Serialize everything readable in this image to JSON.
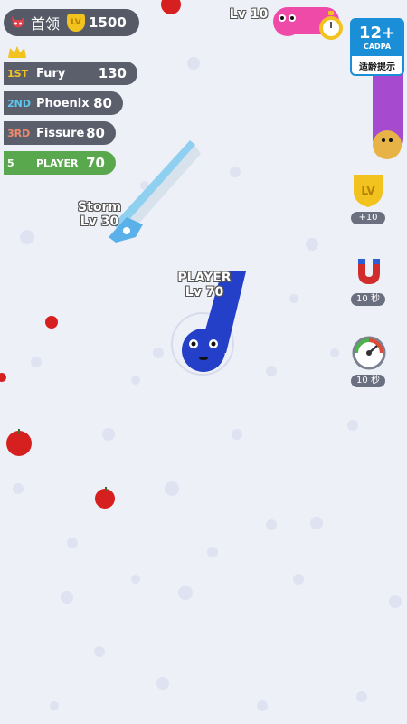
{
  "boss": {
    "label": "首领",
    "lv_icon": "LV",
    "value": "1500"
  },
  "leaderboard": [
    {
      "rank": "1ST",
      "name": "Fury",
      "score": "130",
      "rank_color": "#f2c21f"
    },
    {
      "rank": "2ND",
      "name": "Phoenix",
      "score": "80",
      "rank_color": "#5cc8f0"
    },
    {
      "rank": "3RD",
      "name": "Fissure",
      "score": "80",
      "rank_color": "#f08a6a"
    }
  ],
  "player_row": {
    "rank": "5",
    "name": "PLAYER",
    "score": "70"
  },
  "snakes": {
    "player": {
      "name": "PLAYER",
      "level": "Lv 70"
    },
    "storm": {
      "name": "Storm",
      "level": "Lv 30"
    },
    "top": {
      "level": "Lv 10"
    }
  },
  "age_rating": {
    "age": "12+",
    "org": "CADPA",
    "hint": "适龄提示"
  },
  "powerups": [
    {
      "icon": "lv-shield-icon",
      "label": "+10"
    },
    {
      "icon": "magnet-icon",
      "label": "10 秒"
    },
    {
      "icon": "speedometer-icon",
      "label": "10 秒"
    }
  ],
  "colors": {
    "player_snake": "#2540c8",
    "storm_snake": "#8fd0f0",
    "pink_snake": "#f04aa8",
    "purple_snake": "#a64ad0",
    "apple": "#d61f1f"
  }
}
